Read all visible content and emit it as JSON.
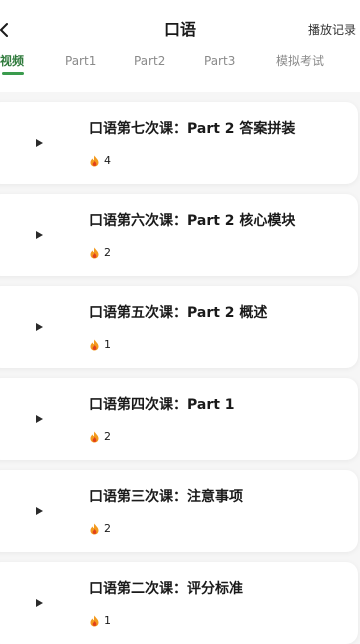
{
  "header": {
    "title": "口语",
    "history_label": "播放记录"
  },
  "tabs": [
    {
      "label": "视频",
      "active": true
    },
    {
      "label": "Part1",
      "active": false
    },
    {
      "label": "Part2",
      "active": false
    },
    {
      "label": "Part3",
      "active": false
    },
    {
      "label": "模拟考试",
      "active": false
    }
  ],
  "lessons": [
    {
      "title": "口语第七次课：Part 2 答案拼装",
      "count": "4"
    },
    {
      "title": "口语第六次课：Part 2 核心模块",
      "count": "2"
    },
    {
      "title": "口语第五次课：Part 2 概述",
      "count": "1"
    },
    {
      "title": "口语第四次课：Part 1",
      "count": "2"
    },
    {
      "title": "口语第三次课：注意事项",
      "count": "2"
    },
    {
      "title": "口语第二次课：评分标准",
      "count": "1"
    }
  ],
  "icons": {
    "back": "chevron-left-icon",
    "play": "play-icon",
    "fire": "fire-icon"
  },
  "colors": {
    "accent": "#2f7a3c",
    "accent_bar": "#3a9b4d",
    "fire_outer": "#f39a1e",
    "fire_inner": "#e2421b"
  }
}
